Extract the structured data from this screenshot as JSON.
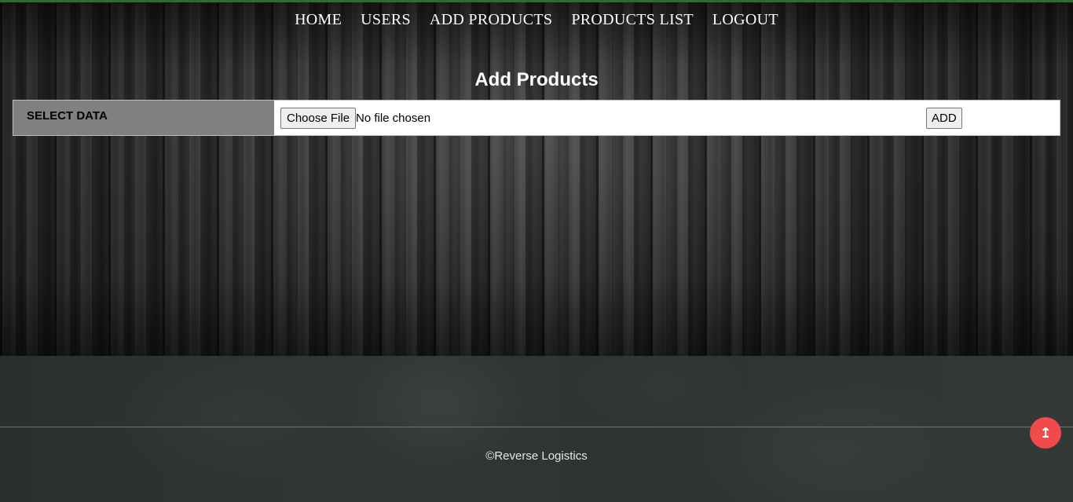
{
  "nav": {
    "items": [
      {
        "label": "HOME"
      },
      {
        "label": "USERS"
      },
      {
        "label": "ADD PRODUCTS"
      },
      {
        "label": "PRODUCTS LIST"
      },
      {
        "label": "LOGOUT"
      }
    ]
  },
  "main": {
    "title": "Add Products",
    "form": {
      "label": "SELECT DATA",
      "file_button_label": "Choose File",
      "file_status": "No file chosen",
      "add_button_label": "ADD"
    }
  },
  "footer": {
    "copyright": "©Reverse Logistics",
    "scroll_top_icon": "↥"
  },
  "colors": {
    "accent_border": "#2e6b35",
    "scroll_button": "#f14a4a",
    "label_cell": "#808080"
  },
  "icons": {
    "scroll_top": "arrow-up-icon"
  }
}
